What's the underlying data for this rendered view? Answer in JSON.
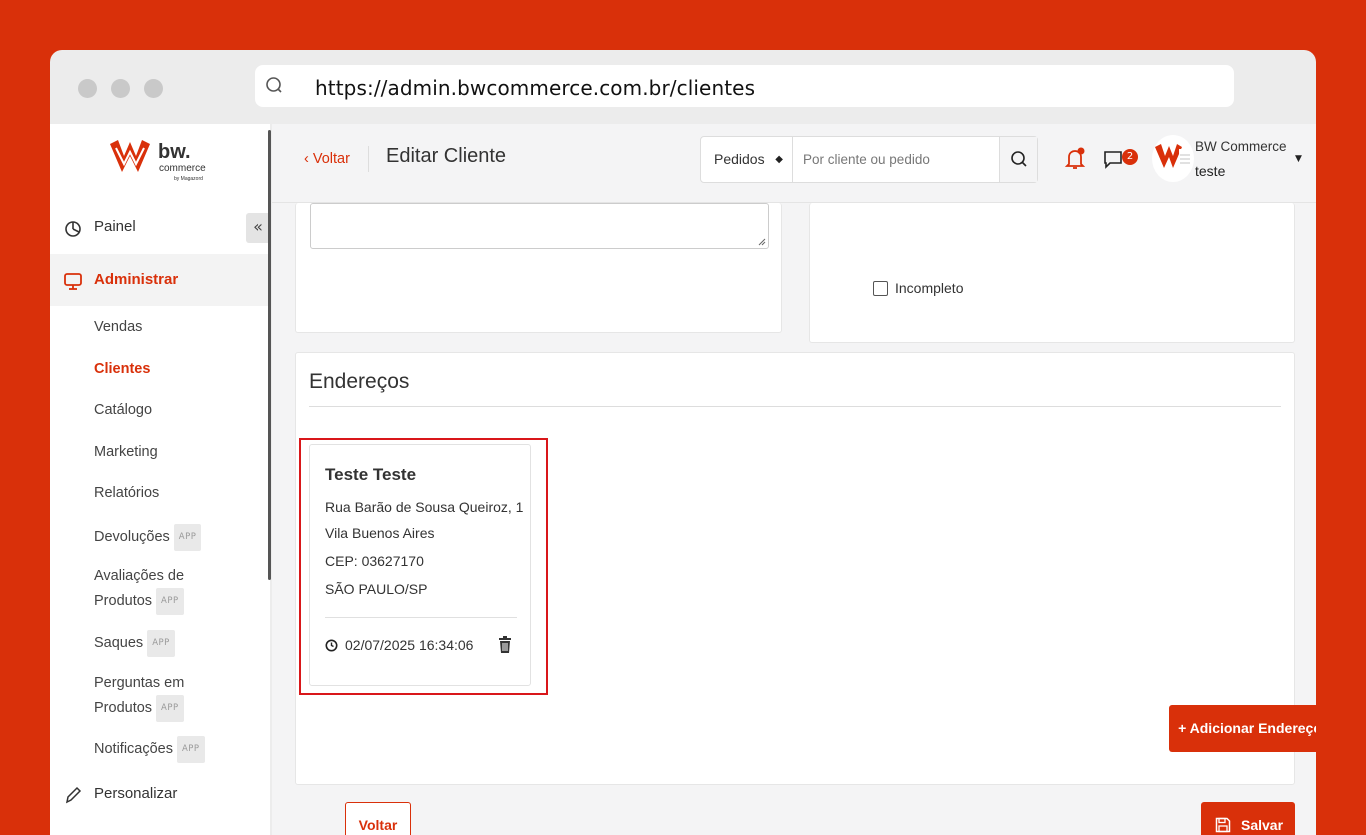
{
  "browser": {
    "url": "https://admin.bwcommerce.com.br/clientes"
  },
  "logo": {
    "brand": "bw.",
    "sub": "commerce",
    "tagline": "by Magazord"
  },
  "sidebar": {
    "painel": "Painel",
    "administrar": "Administrar",
    "collapse": "«",
    "items": [
      {
        "label": "Vendas",
        "app": false
      },
      {
        "label": "Clientes",
        "app": false,
        "active": true
      },
      {
        "label": "Catálogo",
        "app": false
      },
      {
        "label": "Marketing",
        "app": false
      },
      {
        "label": "Relatórios",
        "app": false
      },
      {
        "label": "Devoluções",
        "app": true
      },
      {
        "label": "Avaliações de",
        "label2": "Produtos",
        "app": true
      },
      {
        "label": "Saques",
        "app": true
      },
      {
        "label": "Perguntas em",
        "label2": "Produtos",
        "app": true
      },
      {
        "label": "Notificações",
        "app": true
      }
    ],
    "app_badge": "APP",
    "personalizar": "Personalizar"
  },
  "header": {
    "back": "Voltar",
    "title": "Editar Cliente",
    "search_select": "Pedidos",
    "search_placeholder": "Por cliente ou pedido",
    "chat_count": "2",
    "user_name": "BW Commerce",
    "user_sub": "teste"
  },
  "form": {
    "incompleto": "Incompleto"
  },
  "addresses": {
    "title": "Endereços",
    "card": {
      "name": "Teste Teste",
      "street": "Rua Barão de Sousa Queiroz, 1",
      "district": "Vila Buenos Aires",
      "cep": "CEP: 03627170",
      "city": "SÃO PAULO/SP",
      "datetime": "02/07/2025 16:34:06"
    },
    "add_button": "Adicionar Endereço"
  },
  "footer": {
    "back": "Voltar",
    "save": "Salvar"
  },
  "colors": {
    "accent": "#d9300a",
    "highlight": "#d9171a"
  }
}
